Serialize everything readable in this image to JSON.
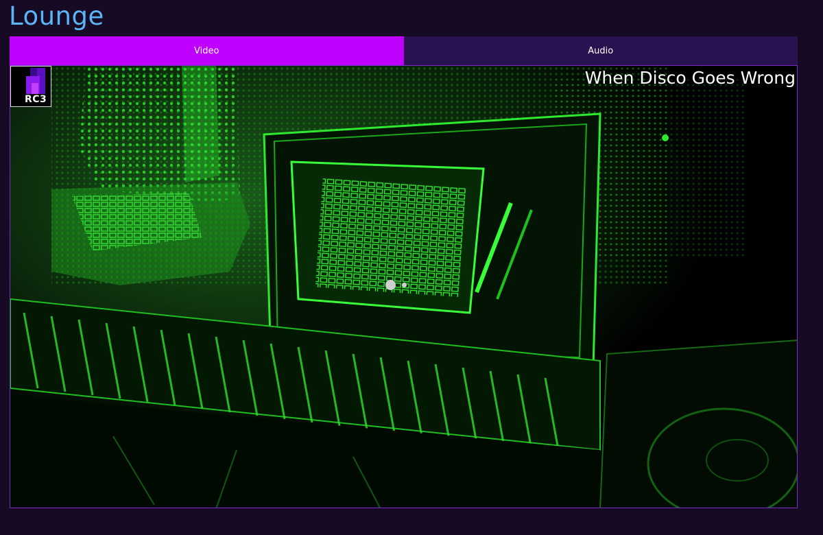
{
  "page": {
    "title": "Lounge"
  },
  "tabs": [
    {
      "label": "Video",
      "active": true
    },
    {
      "label": "Audio",
      "active": false
    }
  ],
  "player": {
    "video_title": "When Disco Goes Wrong",
    "logo_text": "RC3",
    "logo_icon": "rc3-logo-icon",
    "status": "loading"
  },
  "colors": {
    "background": "#170a24",
    "title": "#5bb4f5",
    "tab_active": "#c000ff",
    "tab_inactive": "#2a1150",
    "frame_border": "#7a2cc4",
    "video_tint": "#22ff22"
  }
}
